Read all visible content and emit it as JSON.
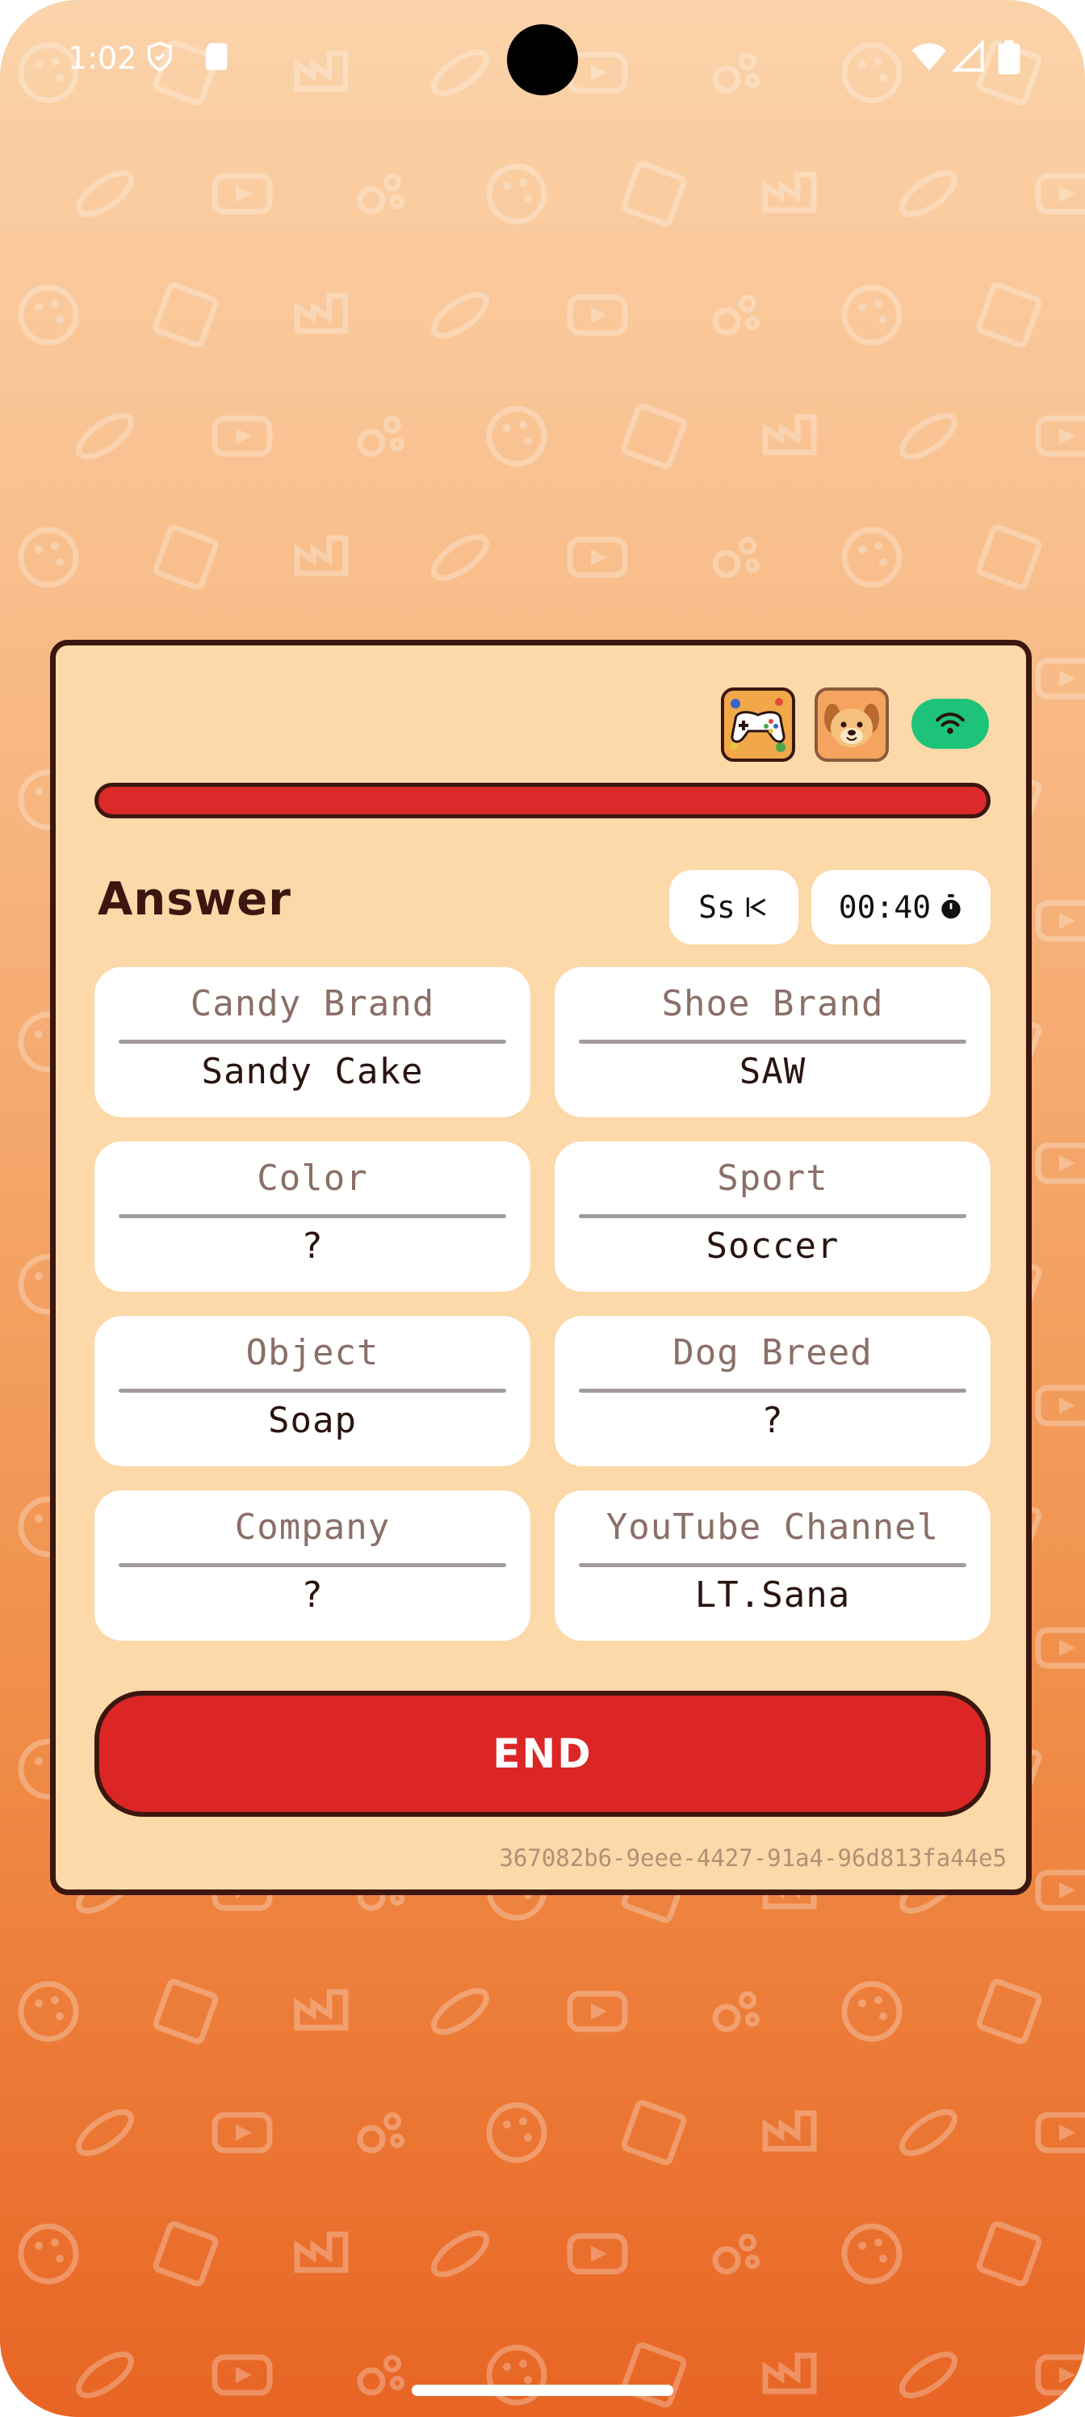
{
  "status_bar": {
    "time": "1:02"
  },
  "header": {
    "game_icon": "gamepad-icon",
    "avatar_icon": "dog-face-icon",
    "connection_icon": "wifi-icon",
    "connection_color": "#1ec37a"
  },
  "progress": {
    "fraction": 1.0,
    "color": "#dc2a2a"
  },
  "title": "Answer",
  "letter_pill": {
    "label": "Ss",
    "icon": "letter-swap-icon"
  },
  "timer_pill": {
    "label": "00:40",
    "icon": "stopwatch-icon"
  },
  "categories": [
    {
      "label": "Candy Brand",
      "value": "Sandy Cake"
    },
    {
      "label": "Shoe Brand",
      "value": "SAW"
    },
    {
      "label": "Color",
      "value": "?"
    },
    {
      "label": "Sport",
      "value": "Soccer"
    },
    {
      "label": "Object",
      "value": "Soap"
    },
    {
      "label": "Dog Breed",
      "value": "?"
    },
    {
      "label": "Company",
      "value": "?"
    },
    {
      "label": "YouTube Channel",
      "value": "LT.Sana"
    }
  ],
  "end_button": {
    "label": "END"
  },
  "session_id": "367082b6-9eee-4427-91a4-96d813fa44e5",
  "colors": {
    "card": "#fdd8a8",
    "border": "#3b1710",
    "accent": "#dc2626"
  }
}
